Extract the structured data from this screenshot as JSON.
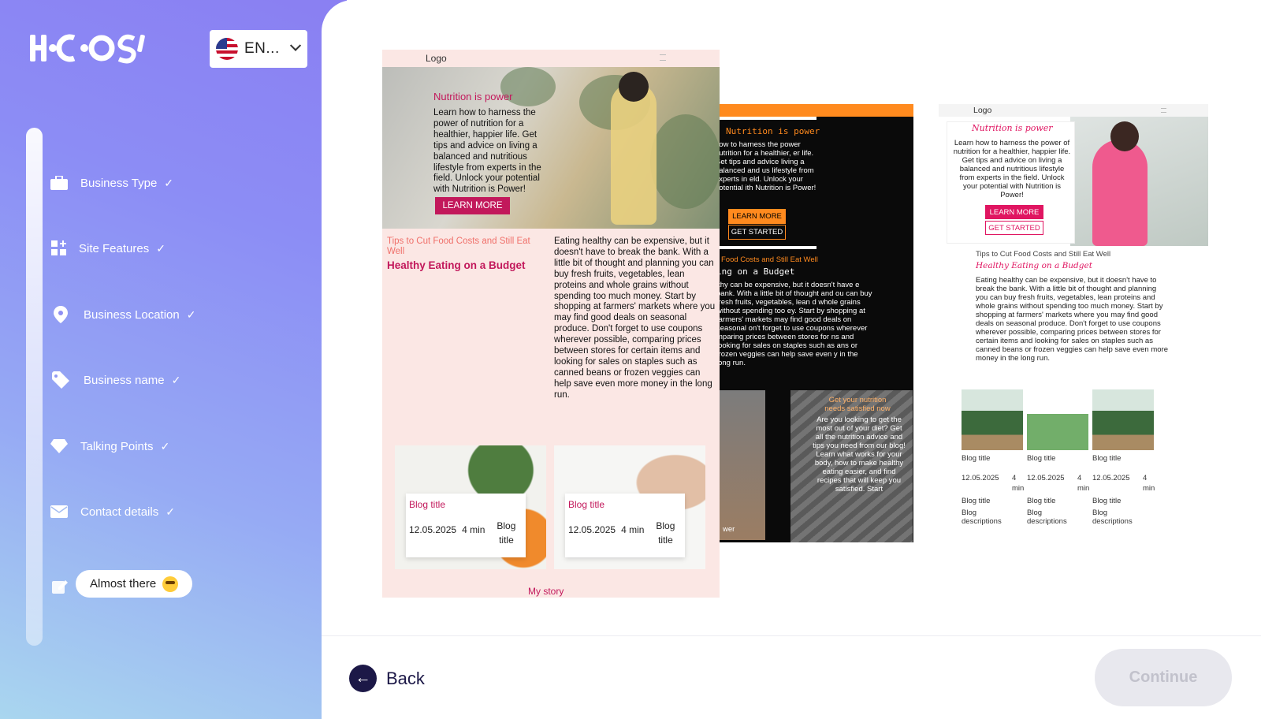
{
  "brand": {
    "logo_text": "H·C·OS"
  },
  "language": {
    "selected": "EN..."
  },
  "steps": [
    {
      "label": "Business Type",
      "icon": "briefcase-icon"
    },
    {
      "label": "Site Features",
      "icon": "grid-plus-icon"
    },
    {
      "label": "Business Location",
      "icon": "map-pin-icon"
    },
    {
      "label": "Business name",
      "icon": "tag-icon"
    },
    {
      "label": "Talking Points",
      "icon": "diamond-icon"
    },
    {
      "label": "Contact details",
      "icon": "envelope-icon"
    }
  ],
  "current_step": {
    "label": "Almost there"
  },
  "nav": {
    "back_label": "Back",
    "continue_label": "Continue"
  },
  "colors": {
    "accent_dark": "#1c1847",
    "t1_accent": "#c2185b",
    "t2_accent": "#ff8a1e",
    "t3_accent": "#e01561"
  },
  "template1": {
    "logo": "Logo",
    "hero_title": "Nutrition is power",
    "hero_text": "Learn how to harness the power of nutrition for a healthier, happier life. Get tips and advice on living a balanced and nutritious lifestyle from experts in the field. Unlock your potential with Nutrition is Power!",
    "hero_button": "LEARN MORE",
    "section_sub": "Tips to Cut Food Costs and Still Eat Well",
    "section_title": "Healthy Eating on a Budget",
    "section_body": "Eating healthy can be expensive, but it doesn't have to break the bank. With a little bit of thought and planning you can buy fresh fruits, vegetables, lean proteins and whole grains without spending too much money. Start by shopping at farmers' markets where you may find good deals on seasonal produce. Don't forget to use coupons wherever possible, comparing prices between stores for certain items and looking for sales on staples such as canned beans or frozen veggies can help save even more money in the long run.",
    "cards": [
      {
        "title": "Blog title",
        "date": "12.05.2025",
        "read": "4 min",
        "subtitle": "Blog title"
      },
      {
        "title": "Blog title",
        "date": "12.05.2025",
        "read": "4 min",
        "subtitle": "Blog title"
      }
    ],
    "story": "My story"
  },
  "template2": {
    "hero_title": "Nutrition is power",
    "hero_text": "how to harness the power nutrition for a healthier, er life. Get tips and advice living a balanced and us lifestyle from experts in eld. Unlock your potential ith Nutrition is Power!",
    "learn_more": "LEARN MORE",
    "get_started": "GET STARTED",
    "section_sub": "Food Costs and Still Eat Well",
    "section_title": "ing on a Budget",
    "section_body": "lthy can be expensive, but it doesn't have e bank. With a little bit of thought and ou can buy fresh fruits, vegetables, lean d whole grains without spending too ey. Start by shopping at farmers' markets may find good deals on seasonal on't forget to use coupons wherever mparing prices between stores for ns and looking for sales on staples such as ans or frozen veggies can help save even y in the long run.",
    "needs_title": "Get your nutrition needs satisfied now",
    "needs_text": "Are you looking to get the most out of your diet? Get all the nutrition advice and tips you need from our blog! Learn what works for your body, how to make healthy eating easier, and find recipes that will keep you satisfied. Start",
    "fragment": "wer"
  },
  "template3": {
    "logo": "Logo",
    "hero_title": "Nutrition is power",
    "hero_text": "Learn how to harness the power of nutrition for a healthier, happier life. Get tips and advice on living a balanced and nutritious lifestyle from experts in the field. Unlock your potential with Nutrition is Power!",
    "learn_more": "LEARN MORE",
    "get_started": "GET STARTED",
    "section_sub": "Tips to Cut Food Costs and Still Eat Well",
    "section_title": "Healthy Eating on a Budget",
    "section_body": "Eating healthy can be expensive, but it doesn't have to break the bank. With a little bit of thought and planning you can buy fresh fruits, vegetables, lean proteins and whole grains without spending too much money. Start by shopping at farmers' markets where you may find good deals on seasonal produce. Don't forget to use coupons wherever possible, comparing prices between stores for certain items and looking for sales on staples such as canned beans or frozen veggies can help save even more money in the long run.",
    "blogs": [
      {
        "title": "Blog title",
        "date": "12.05.2025",
        "read": "4 min",
        "subtitle": "Blog title",
        "desc": "Blog descriptions"
      },
      {
        "title": "Blog title",
        "date": "12.05.2025",
        "read": "4 min",
        "subtitle": "Blog title",
        "desc": "Blog descriptions"
      },
      {
        "title": "Blog title",
        "date": "12.05.2025",
        "read": "4 min",
        "subtitle": "Blog title",
        "desc": "Blog descriptions"
      }
    ]
  }
}
